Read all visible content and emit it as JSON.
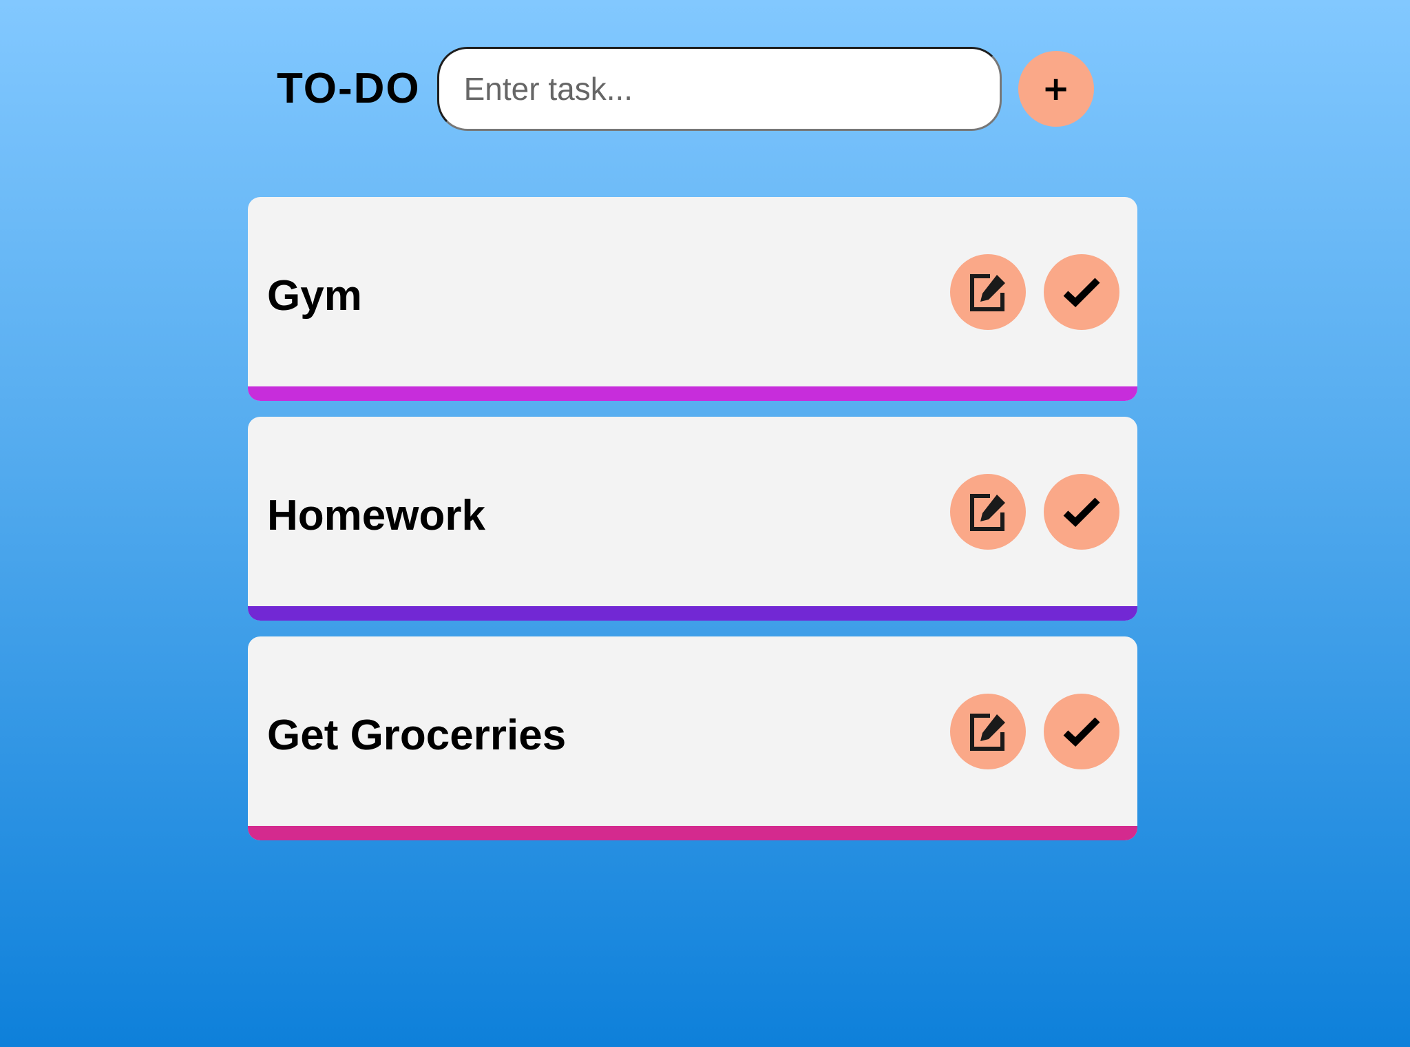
{
  "header": {
    "title": "TO-DO",
    "input_placeholder": "Enter task...",
    "input_value": "",
    "add_button_label": "+"
  },
  "tasks": [
    {
      "label": "Gym",
      "stripe_color": "#c72ddb"
    },
    {
      "label": "Homework",
      "stripe_color": "#7228d4"
    },
    {
      "label": "Get Grocerries",
      "stripe_color": "#d42a8e"
    }
  ],
  "icons": {
    "edit": "edit-icon",
    "complete": "checkmark-icon"
  },
  "colors": {
    "accent": "#faa888",
    "card_background": "#f3f3f3"
  }
}
